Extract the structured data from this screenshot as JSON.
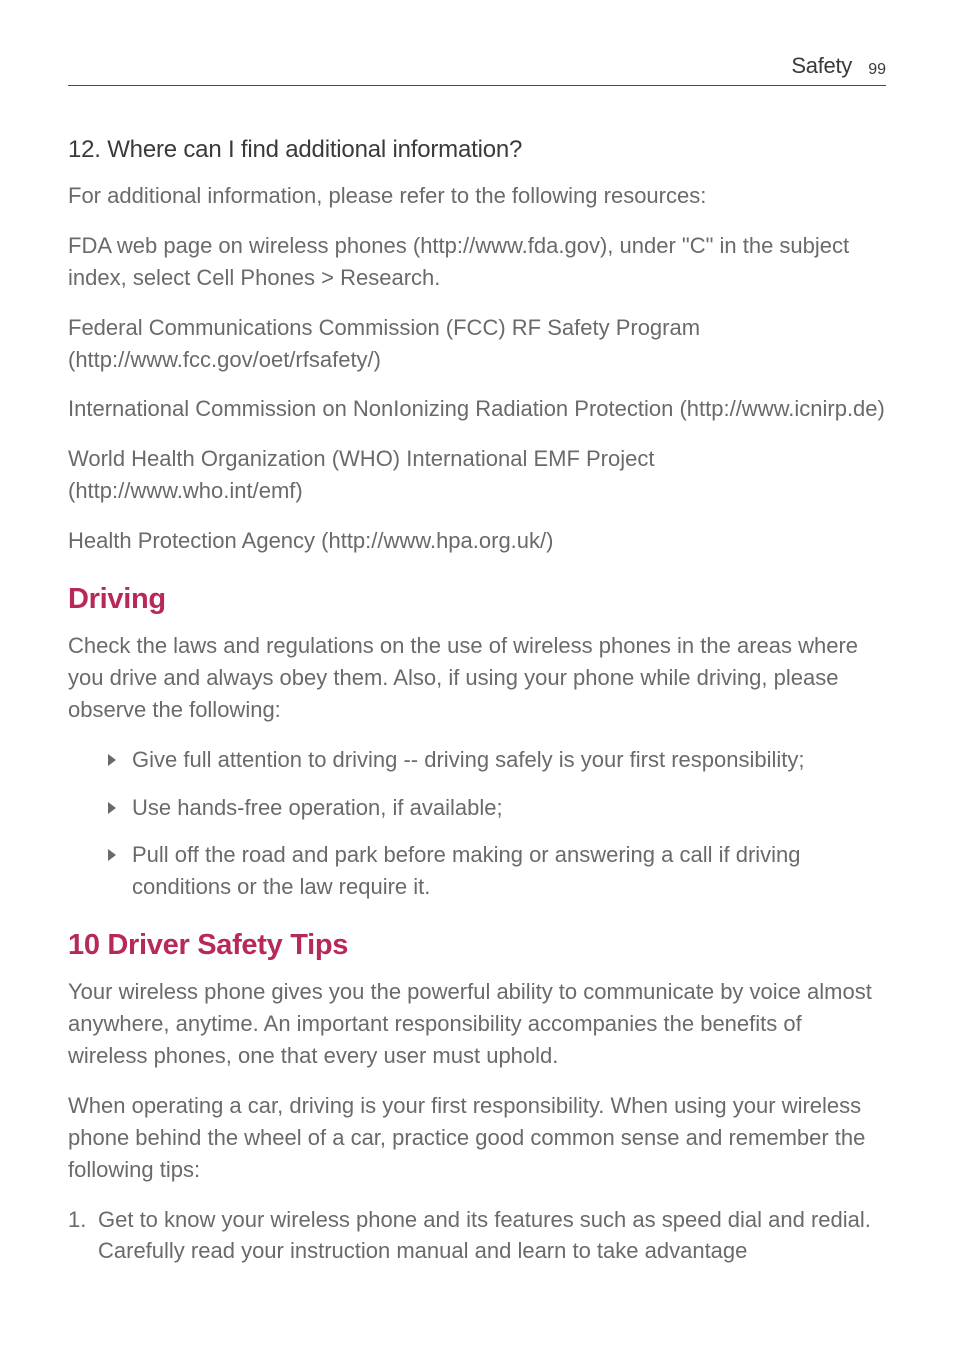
{
  "header": {
    "title": "Safety",
    "page": "99"
  },
  "section12": {
    "heading": "12. Where can I find additional information?",
    "p1": "For additional information, please refer to the following resources:",
    "p2": "FDA web page on wireless phones (http://www.fda.gov), under \"C\" in the subject index, select Cell Phones > Research.",
    "p3": "Federal Communications Commission (FCC) RF Safety Program (http://www.fcc.gov/oet/rfsafety/)",
    "p4": "International Commission on NonIonizing Radiation Protection (http://www.icnirp.de)",
    "p5": "World Health Organization (WHO) International EMF Project (http://www.who.int/emf)",
    "p6": "Health Protection Agency (http://www.hpa.org.uk/)"
  },
  "driving": {
    "heading": "Driving",
    "intro": "Check the laws and regulations on the use of wireless phones in the areas where you drive and always obey them. Also, if using your phone while driving, please observe the following:",
    "bullets": [
      "Give full attention to driving -- driving safely is your first responsibility;",
      "Use hands-free operation, if available;",
      "Pull off the road and park before making or answering a call if driving conditions or the law require it."
    ]
  },
  "tips": {
    "heading": "10 Driver Safety Tips",
    "p1": "Your wireless phone gives you the powerful ability to communicate by voice almost anywhere, anytime. An important responsibility accompanies the benefits of wireless phones, one that every user must uphold.",
    "p2": "When operating a car, driving is your first responsibility. When using your wireless phone behind the wheel of a car, practice good common sense and remember the following tips:",
    "items": [
      "Get to know your wireless phone and its features such as speed dial and redial. Carefully read your instruction manual and learn to take advantage"
    ]
  }
}
